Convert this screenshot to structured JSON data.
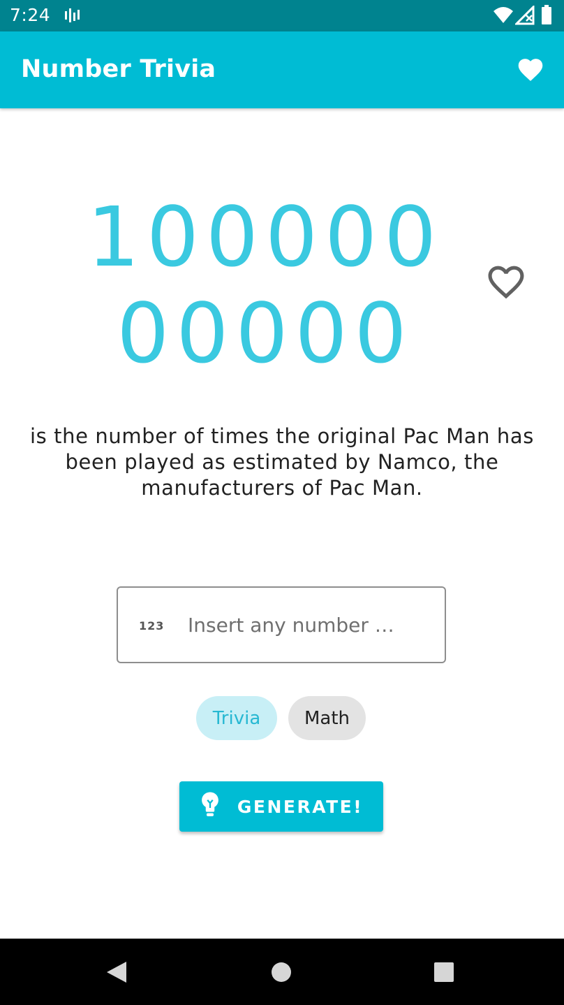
{
  "status_bar": {
    "time": "7:24",
    "icons": [
      "network-activity-icon",
      "wifi-icon",
      "signal-icon",
      "battery-icon"
    ]
  },
  "app_bar": {
    "title": "Number Trivia",
    "favorites_icon": "heart-filled-icon"
  },
  "number": {
    "line1": "100000",
    "line2": "00000"
  },
  "favorite_toggle_icon": "heart-outline-icon",
  "fact": "is the number of times the original Pac Man has been played as estimated by Namco, the manufacturers of Pac Man.",
  "input": {
    "icon_text": "123",
    "placeholder": "Insert any number …",
    "value": ""
  },
  "chips": {
    "trivia": "Trivia",
    "math": "Math",
    "selected": "Trivia"
  },
  "generate_button": {
    "label": "GENERATE!",
    "icon": "lightbulb-icon"
  },
  "nav_bar": {
    "icons": [
      "back-icon",
      "home-icon",
      "recents-icon"
    ]
  },
  "colors": {
    "status_bar": "#00838f",
    "primary": "#00bcd4",
    "number": "#3ac9e0",
    "chip_selected_bg": "#c8eff6",
    "chip_bg": "#e3e3e3"
  }
}
